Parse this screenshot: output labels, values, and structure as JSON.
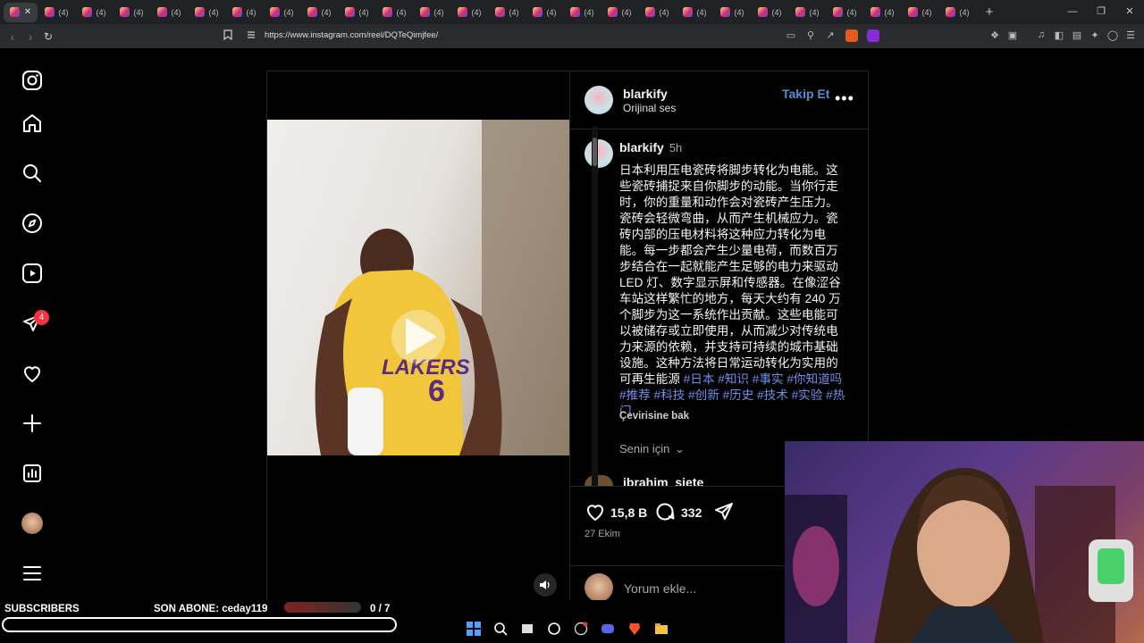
{
  "browser": {
    "tab_count_label": "(4)",
    "tabs": [
      "",
      "(4)",
      "(4)",
      "(4)",
      "(4)",
      "(4)",
      "(4)",
      "(4)",
      "(4)",
      "(4)",
      "(4)",
      "(4)",
      "(4)",
      "(4)",
      "(4)",
      "(4)",
      "(4)",
      "(4)",
      "(4)",
      "(4)",
      "(4)",
      "(4)",
      "(4)",
      "(4)",
      "(4)",
      "(4)"
    ],
    "url": "https://www.instagram.com/reel/DQTeQimjfee/"
  },
  "post": {
    "author": "blarkify",
    "audio": "Orijinal ses",
    "follow_label": "Takip Et",
    "caption_author": "blarkify",
    "caption_time": "5h",
    "caption_text": "日本利用压电瓷砖将脚步转化为电能。这些瓷砖捕捉来自你脚步的动能。当你行走时，你的重量和动作会对瓷砖产生压力。瓷砖会轻微弯曲，从而产生机械应力。瓷砖内部的压电材料将这种应力转化为电能。每一步都会产生少量电荷，而数百万步结合在一起就能产生足够的电力来驱动LED 灯、数字显示屏和传感器。在像涩谷车站这样繁忙的地方，每天大约有 240 万个脚步为这一系统作出贡献。这些电能可以被储存或立即使用，从而减少对传统电力来源的依赖，并支持可持续的城市基础设施。这种方法将日常运动转化为实用的可再生能源 ",
    "caption_tags": "#日本 #知识 #事实 #你知道吗 #推荐 #科技 #创新 #历史 #技术 #实验 #热门",
    "translate_label": "Çevirisine bak",
    "for_you_label": "Senin için",
    "next_comment_user": "ibrahim_siete",
    "likes": "15,8 B",
    "comments": "332",
    "date": "27 Ekim",
    "comment_placeholder": "Yorum ekle..."
  },
  "sidebar": {
    "notification_count": "4"
  },
  "stream_overlay": {
    "subscribers_label": "SUBSCRIBERS",
    "last_sub_label": "SON ABONE: ceday119",
    "goal": "0  / 7",
    "goal_progress": 0
  },
  "colors": {
    "link": "#4e8fd6",
    "hashtag": "#6f8fe8",
    "badge": "#ff3040"
  }
}
